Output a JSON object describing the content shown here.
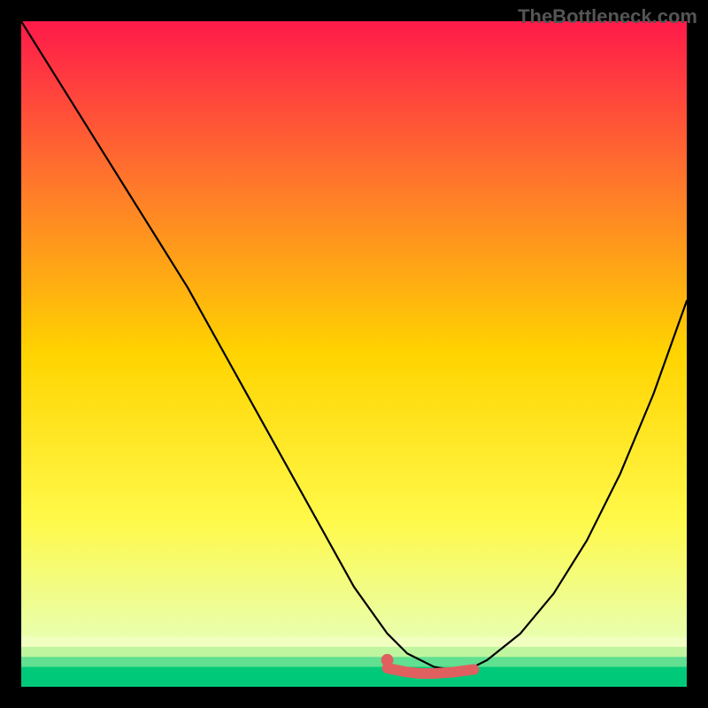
{
  "watermark": "TheBottleneck.com",
  "chart_data": {
    "type": "line",
    "title": "",
    "xlabel": "",
    "ylabel": "",
    "xlim": [
      0,
      100
    ],
    "ylim": [
      0,
      100
    ],
    "grid": false,
    "legend": false,
    "annotations": [],
    "gradient_stops": [
      {
        "offset": 0.0,
        "color": "#ff1a4a"
      },
      {
        "offset": 0.25,
        "color": "#ff7a2a"
      },
      {
        "offset": 0.5,
        "color": "#ffd400"
      },
      {
        "offset": 0.75,
        "color": "#fff94a"
      },
      {
        "offset": 0.93,
        "color": "#e8ffb0"
      },
      {
        "offset": 0.97,
        "color": "#8fff8f"
      },
      {
        "offset": 1.0,
        "color": "#00e07a"
      }
    ],
    "series": [
      {
        "name": "curve",
        "color": "#000000",
        "x": [
          0,
          5,
          10,
          15,
          20,
          25,
          30,
          35,
          40,
          45,
          50,
          55,
          58,
          60,
          62,
          65,
          68,
          70,
          75,
          80,
          85,
          90,
          95,
          100
        ],
        "y": [
          100,
          92,
          84,
          76,
          68,
          60,
          51,
          42,
          33,
          24,
          15,
          8,
          5,
          4,
          3,
          2.5,
          3,
          4,
          8,
          14,
          22,
          32,
          44,
          58
        ]
      },
      {
        "name": "flat-highlight",
        "color": "#e06060",
        "style": "thick",
        "x": [
          55,
          58,
          60,
          62,
          65,
          68
        ],
        "y": [
          2.8,
          2.2,
          2.0,
          2.0,
          2.2,
          2.6
        ]
      }
    ],
    "marker": {
      "x": 55,
      "y": 4,
      "color": "#e06060"
    },
    "bottom_bands": [
      {
        "y0": 0,
        "y1": 3,
        "color": "#00c97a"
      },
      {
        "y0": 3,
        "y1": 4.5,
        "color": "#60e090"
      },
      {
        "y0": 4.5,
        "y1": 6,
        "color": "#c0f5a0"
      },
      {
        "y0": 6,
        "y1": 7.5,
        "color": "#f0ffc0"
      }
    ]
  }
}
